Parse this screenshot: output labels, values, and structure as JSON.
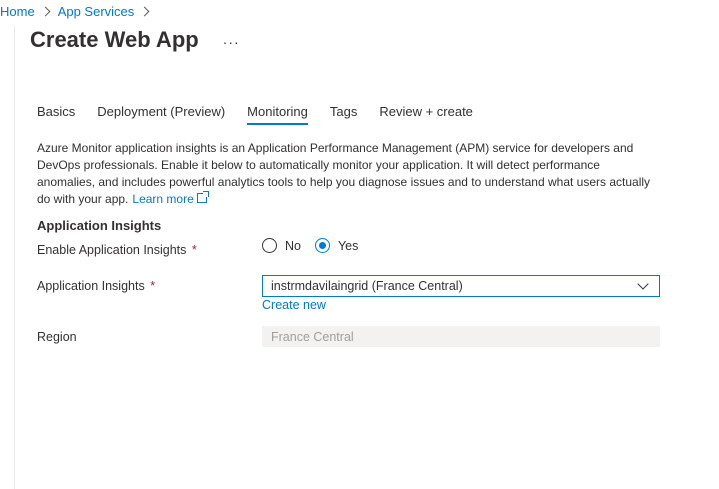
{
  "breadcrumb": {
    "home": "Home",
    "app_services": "App Services"
  },
  "page": {
    "title": "Create Web App",
    "more": "···"
  },
  "tabs": [
    {
      "label": "Basics",
      "active": false
    },
    {
      "label": "Deployment (Preview)",
      "active": false
    },
    {
      "label": "Monitoring",
      "active": true
    },
    {
      "label": "Tags",
      "active": false
    },
    {
      "label": "Review + create",
      "active": false
    }
  ],
  "description": {
    "text": "Azure Monitor application insights is an Application Performance Management (APM) service for developers and DevOps professionals. Enable it below to automatically monitor your application. It will detect performance anomalies, and includes powerful analytics tools to help you diagnose issues and to understand what users actually do with your app.",
    "learn_more": "Learn more"
  },
  "section": {
    "title": "Application Insights"
  },
  "enable_field": {
    "label": "Enable Application Insights",
    "required": "*",
    "options": [
      {
        "label": "No",
        "checked": false
      },
      {
        "label": "Yes",
        "checked": true
      }
    ]
  },
  "insights_field": {
    "label": "Application Insights",
    "required": "*",
    "value": "instrmdavilaingrid (France Central)",
    "create_new": "Create new"
  },
  "region_field": {
    "label": "Region",
    "value": "France Central"
  },
  "colors": {
    "accent": "#0078d4",
    "required": "#a4262c",
    "disabled_bg": "#f3f2f1"
  }
}
